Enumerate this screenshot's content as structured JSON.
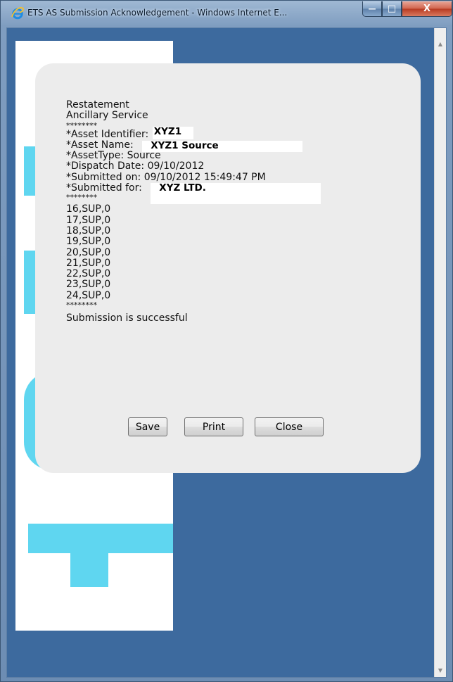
{
  "window": {
    "title": "ETS AS Submission Acknowledgement - Windows Internet E...",
    "minimize_glyph": "—",
    "maximize_glyph": "□",
    "close_glyph": "X"
  },
  "dialog": {
    "heading1": "Restatement",
    "heading2": "Ancillary Service",
    "separator": "********",
    "asset_identifier_label": "*Asset Identifier:",
    "asset_identifier_value": "XYZ1",
    "asset_name_label": "*Asset Name:",
    "asset_name_value": "XYZ1 Source",
    "asset_type": "*AssetType: Source",
    "dispatch_date": "*Dispatch Date: 09/10/2012",
    "submitted_on": "*Submitted on: 09/10/2012 15:49:47 PM",
    "submitted_for_label": "*Submitted for:",
    "submitted_for_value": "XYZ LTD.",
    "records": [
      "16,SUP,0",
      "17,SUP,0",
      "18,SUP,0",
      "19,SUP,0",
      "20,SUP,0",
      "21,SUP,0",
      "22,SUP,0",
      "23,SUP,0",
      "24,SUP,0"
    ],
    "status": "Submission is successful",
    "buttons": {
      "save": "Save",
      "print": "Print",
      "close": "Close"
    }
  },
  "colors": {
    "page_background": "#3d6a9e",
    "dialog_background": "#ececec",
    "accent_cyan": "#5fd6f0"
  }
}
